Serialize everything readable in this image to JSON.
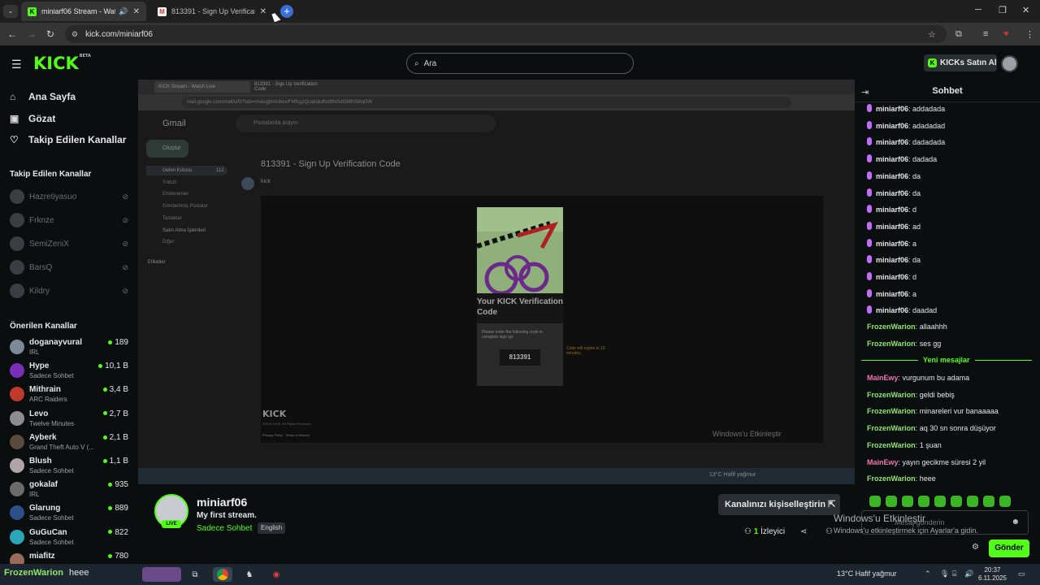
{
  "browser": {
    "tabs": [
      {
        "title": "miniarf06 Stream - Watch Live",
        "active": true
      },
      {
        "title": "813391 - Sign Up Verification Code",
        "active": false
      }
    ],
    "url": "kick.com/miniarf06"
  },
  "header": {
    "logo": "KICK",
    "logo_beta": "BETA",
    "search_placeholder": "Ara",
    "buy_kicks": "KICKs Satın Al"
  },
  "sidebar": {
    "nav": [
      {
        "label": "Ana Sayfa",
        "icon": "home-icon"
      },
      {
        "label": "Gözat",
        "icon": "browse-icon"
      },
      {
        "label": "Takip Edilen Kanallar",
        "icon": "heart-icon"
      }
    ],
    "followed_heading": "Takip Edilen Kanallar",
    "followed": [
      "Hazretiyasuo",
      "Frknze",
      "SemiZeniX",
      "BarsQ",
      "Kildry"
    ],
    "recommended_heading": "Önerilen Kanallar",
    "recommended": [
      {
        "name": "doganayvural",
        "category": "IRL",
        "viewers": "189",
        "color": "#7b8a99"
      },
      {
        "name": "Hype",
        "category": "Sadece Sohbet",
        "viewers": "10,1 B",
        "color": "#7a2fb8"
      },
      {
        "name": "Mithrain",
        "category": "ARC Raiders",
        "viewers": "3,4 B",
        "color": "#c0392b"
      },
      {
        "name": "Levo",
        "category": "Twelve Minutes",
        "viewers": "2,7 B",
        "color": "#8d8d8d"
      },
      {
        "name": "Ayberk",
        "category": "Grand Theft Auto V (...",
        "viewers": "2,1 B",
        "color": "#5c4a3c"
      },
      {
        "name": "Blush",
        "category": "Sadece Sohbet",
        "viewers": "1,1 B",
        "color": "#b0a4a4"
      },
      {
        "name": "gokalaf",
        "category": "IRL",
        "viewers": "935",
        "color": "#6b6b6b"
      },
      {
        "name": "Glarung",
        "category": "Sadece Sohbet",
        "viewers": "889",
        "color": "#2c4f8a"
      },
      {
        "name": "GuGuCan",
        "category": "Sadece Sohbet",
        "viewers": "822",
        "color": "#2aa6b8"
      },
      {
        "name": "miafitz",
        "category": "",
        "viewers": "780",
        "color": "#9a6b5a"
      }
    ]
  },
  "video": {
    "inner_tabs": [
      "KICK Stream - Watch Live",
      "813391 - Sign Up Verification Code"
    ],
    "inner_url": "mail.google.com/mail/u/0/?tab=rm&ogbl#inbox/FMfcgzQcqkskdNzBNGdGMfrSWqGW",
    "gmail_logo": "Gmail",
    "gmail_search": "Postalarda arayın",
    "compose": "Oluştur",
    "folders": [
      "Gelen Kutusu",
      "Yıldızlı",
      "Ertelenenler",
      "Gönderilmiş Postalar",
      "Taslaklar",
      "Satın Alma İşlemleri",
      "Diğer"
    ],
    "inbox_count": "112",
    "labels_heading": "Etiketler",
    "subject": "813391 - Sign Up Verification Code",
    "sender": "kick",
    "email_heading": "Your KICK Verification Code",
    "email_instructions": "Please enter the following code to complete sign up:",
    "code": "813391",
    "expire_note": "Code will expire in 10 minutes.",
    "footer_logo": "KICK",
    "footer_rights": "©2025 KICK, All Rights Reserved",
    "footer_links": "Privacy Policy · Terms of Service",
    "windows_activate": "Windows'u Etkinleştir",
    "inner_weather": "13°C Hafif yağmur"
  },
  "stream": {
    "channel": "miniarf06",
    "live": "LIVE",
    "title": "My first stream.",
    "category": "Sadece Sohbet",
    "language": "English",
    "customize_button": "Kanalınızı kişiselleştirin",
    "viewers_count": "1",
    "viewers_label": "İzleyici"
  },
  "chat": {
    "title": "Sohbet",
    "messages": [
      {
        "user": "miniarf06",
        "text": "addadada",
        "color": "#e6e6e6",
        "badge": true
      },
      {
        "user": "miniarf06",
        "text": "adadadad",
        "color": "#e6e6e6",
        "badge": true
      },
      {
        "user": "miniarf06",
        "text": "dadadada",
        "color": "#e6e6e6",
        "badge": true
      },
      {
        "user": "miniarf06",
        "text": "dadada",
        "color": "#e6e6e6",
        "badge": true
      },
      {
        "user": "miniarf06",
        "text": "da",
        "color": "#e6e6e6",
        "badge": true
      },
      {
        "user": "miniarf06",
        "text": "da",
        "color": "#e6e6e6",
        "badge": true
      },
      {
        "user": "miniarf06",
        "text": "d",
        "color": "#e6e6e6",
        "badge": true
      },
      {
        "user": "miniarf06",
        "text": "ad",
        "color": "#e6e6e6",
        "badge": true
      },
      {
        "user": "miniarf06",
        "text": "a",
        "color": "#e6e6e6",
        "badge": true
      },
      {
        "user": "miniarf06",
        "text": "da",
        "color": "#e6e6e6",
        "badge": true
      },
      {
        "user": "miniarf06",
        "text": "d",
        "color": "#e6e6e6",
        "badge": true
      },
      {
        "user": "miniarf06",
        "text": "a",
        "color": "#e6e6e6",
        "badge": true
      },
      {
        "user": "miniarf06",
        "text": "daadad",
        "color": "#e6e6e6",
        "badge": true
      },
      {
        "user": "FrozenWarion",
        "text": "allaahhh",
        "color": "#8fe66f",
        "badge": false
      },
      {
        "user": "FrozenWarion",
        "text": "ses gg",
        "color": "#8fe66f",
        "badge": false
      }
    ],
    "new_messages_label": "Yeni mesajlar",
    "new_messages": [
      {
        "user": "MainEwy",
        "text": "vurgunum bu adama",
        "color": "#f075b5"
      },
      {
        "user": "FrozenWarion",
        "text": "geldi bebiş",
        "color": "#8fe66f"
      },
      {
        "user": "FrozenWarion",
        "text": "minareleri vur banaaaaa",
        "color": "#8fe66f"
      },
      {
        "user": "FrozenWarion",
        "text": "aq 30 sn sonra düşüyor",
        "color": "#8fe66f"
      },
      {
        "user": "FrozenWarion",
        "text": "1 şuan",
        "color": "#8fe66f"
      },
      {
        "user": "MainEwy",
        "text": "yayın gecikme süresi 2 yil",
        "color": "#f075b5"
      },
      {
        "user": "FrozenWarion",
        "text": "heee",
        "color": "#8fe66f"
      }
    ],
    "input_placeholder": "Mesaj gönderin",
    "send_button": "Gönder",
    "windows_activate_title": "Windows'u Etkinleştir",
    "windows_activate_sub": "Windows'u etkinleştirmek için Ayarlar'a gidin."
  },
  "taskbar": {
    "overlay_user": "FrozenWarion",
    "overlay_text": "heee",
    "weather": "13°C  Hafif yağmur",
    "time": "20:37",
    "date": "6.11.2025"
  }
}
